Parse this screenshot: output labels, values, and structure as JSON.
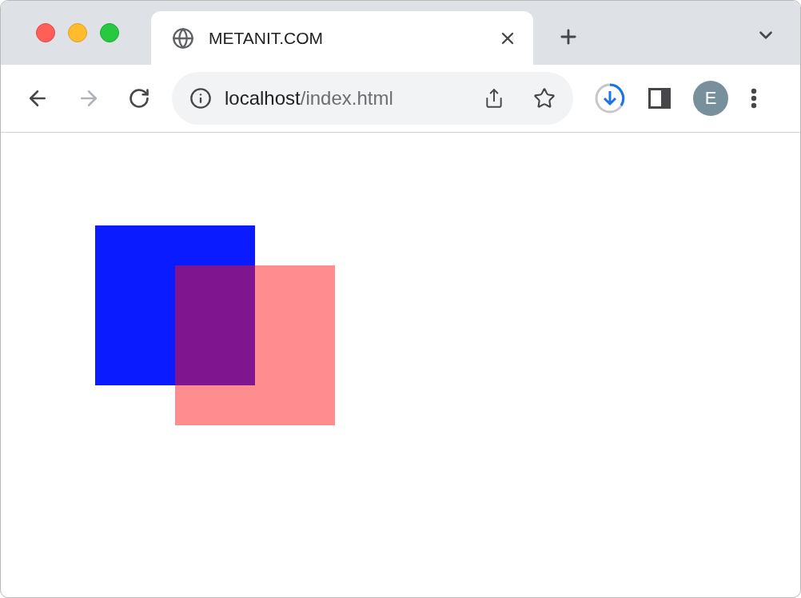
{
  "tab": {
    "title": "METANIT.COM",
    "selected": true
  },
  "toolbar": {
    "back": {
      "disabled": false
    },
    "forward": {
      "disabled": true
    }
  },
  "address_bar": {
    "host": "localhost",
    "path": "/index.html"
  },
  "profile": {
    "initial": "E"
  }
}
